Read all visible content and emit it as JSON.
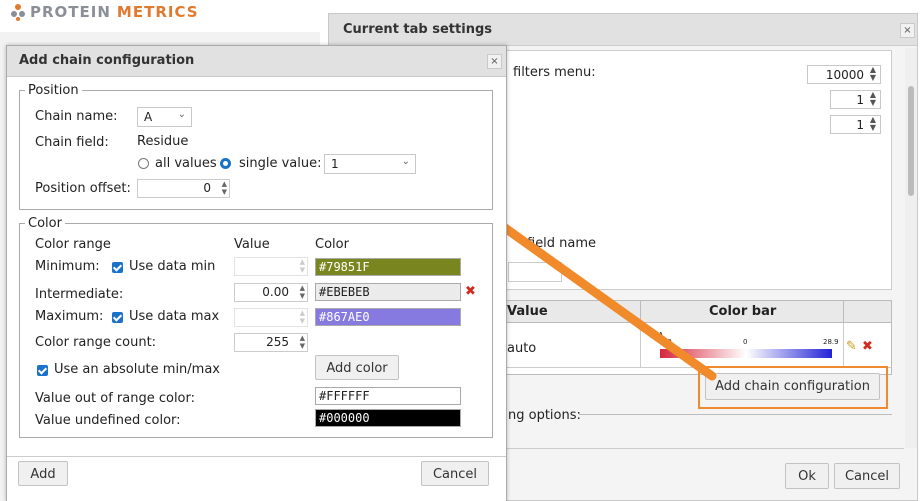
{
  "logo": {
    "brand_a": "PROTEIN",
    "brand_b": "METRICS"
  },
  "back": {
    "title": "Current tab settings",
    "close": "×",
    "filters_label": "filters menu:",
    "spin1": "10000",
    "spin2": "1",
    "spin3": "1",
    "field_name_label": "field name",
    "col_value": "Value",
    "col_colorbar": "Color bar",
    "row_value": "auto",
    "bar_label": "A",
    "tick_min": "-3.9",
    "tick_mid": "0",
    "tick_max": "28.9",
    "add_chain_btn": "Add chain configuration",
    "options_label": "ng options:",
    "ok": "Ok",
    "cancel": "Cancel"
  },
  "dialog": {
    "title": "Add chain configuration",
    "close": "×",
    "position": {
      "legend": "Position",
      "chain_name_label": "Chain name:",
      "chain_name_value": "A",
      "chain_field_label": "Chain field:",
      "chain_field_value": "Residue",
      "all_values": "all values",
      "single_value": "single value:",
      "single_value_value": "1",
      "offset_label": "Position offset:",
      "offset_value": "0"
    },
    "color": {
      "legend": "Color",
      "range_label": "Color range",
      "value_header": "Value",
      "color_header": "Color",
      "min_label": "Minimum:",
      "use_data_min": "Use data min",
      "min_color": "#79851F",
      "inter_label": "Intermediate:",
      "inter_value": "0.00",
      "inter_color": "#EBEBEB",
      "max_label": "Maximum:",
      "use_data_max": "Use data max",
      "max_color": "#867AE0",
      "count_label": "Color range count:",
      "count_value": "255",
      "absolute_label": "Use an absolute min/max",
      "add_color": "Add color",
      "out_of_range_label": "Value out of range color:",
      "out_of_range_color": "#FFFFFF",
      "undefined_label": "Value undefined color:",
      "undefined_color": "#000000"
    },
    "add_btn": "Add",
    "cancel_btn": "Cancel"
  },
  "colors": {
    "accent": "#ef8a2e",
    "checkbox": "#1a73c9"
  }
}
